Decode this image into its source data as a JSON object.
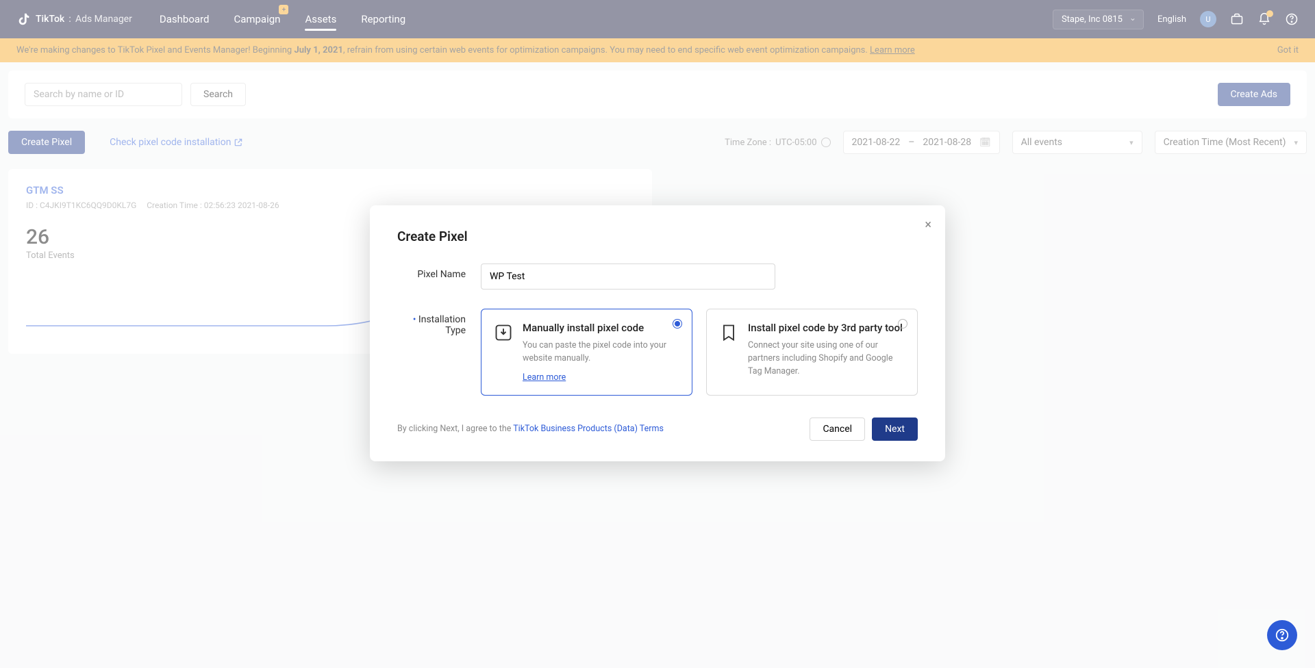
{
  "header": {
    "brand": "TikTok",
    "product": "Ads Manager",
    "nav": {
      "dashboard": "Dashboard",
      "campaign": "Campaign",
      "assets": "Assets",
      "reporting": "Reporting"
    },
    "account": "Stape, Inc 0815",
    "language": "English",
    "avatar_initial": "U"
  },
  "banner": {
    "prefix": "We're making changes to TikTok Pixel and Events Manager! Beginning ",
    "bold": "July 1, 2021",
    "suffix": ", refrain from using certain web events for optimization campaigns. You may need to end specific web event optimization campaigns. ",
    "learn_more": "Learn more",
    "got_it": "Got it"
  },
  "toolbar": {
    "search_placeholder": "Search by name or ID",
    "search_btn": "Search",
    "create_ads": "Create Ads"
  },
  "row2": {
    "create_pixel": "Create Pixel",
    "check_install": "Check pixel code installation",
    "timezone_label": "Time Zone : ",
    "timezone_value": "UTC-05:00",
    "date_start": "2021-08-22",
    "date_end": "2021-08-28",
    "events_filter": "All events",
    "sort": "Creation Time (Most Recent)"
  },
  "card": {
    "name": "GTM SS",
    "id_label": "ID : ",
    "id_value": "C4JKI9T1KC6QQ9D0KL7G",
    "creation_label": "Creation Time : ",
    "creation_value": "02:56:23 2021-08-26",
    "count": "26",
    "count_label": "Total Events"
  },
  "modal": {
    "title": "Create Pixel",
    "pixel_name_label": "Pixel Name",
    "pixel_name_value": "WP Test",
    "install_type_label": "Installation Type",
    "opt1_title": "Manually install pixel code",
    "opt1_desc": "You can paste the pixel code into your website manually.",
    "opt1_learn": "Learn more",
    "opt2_title": "Install pixel code by 3rd party tool",
    "opt2_desc": "Connect your site using one of our partners including Shopify and Google Tag Manager.",
    "terms_prefix": "By clicking Next, I agree to the ",
    "terms_link": "TikTok Business Products (Data) Terms",
    "cancel": "Cancel",
    "next": "Next"
  }
}
